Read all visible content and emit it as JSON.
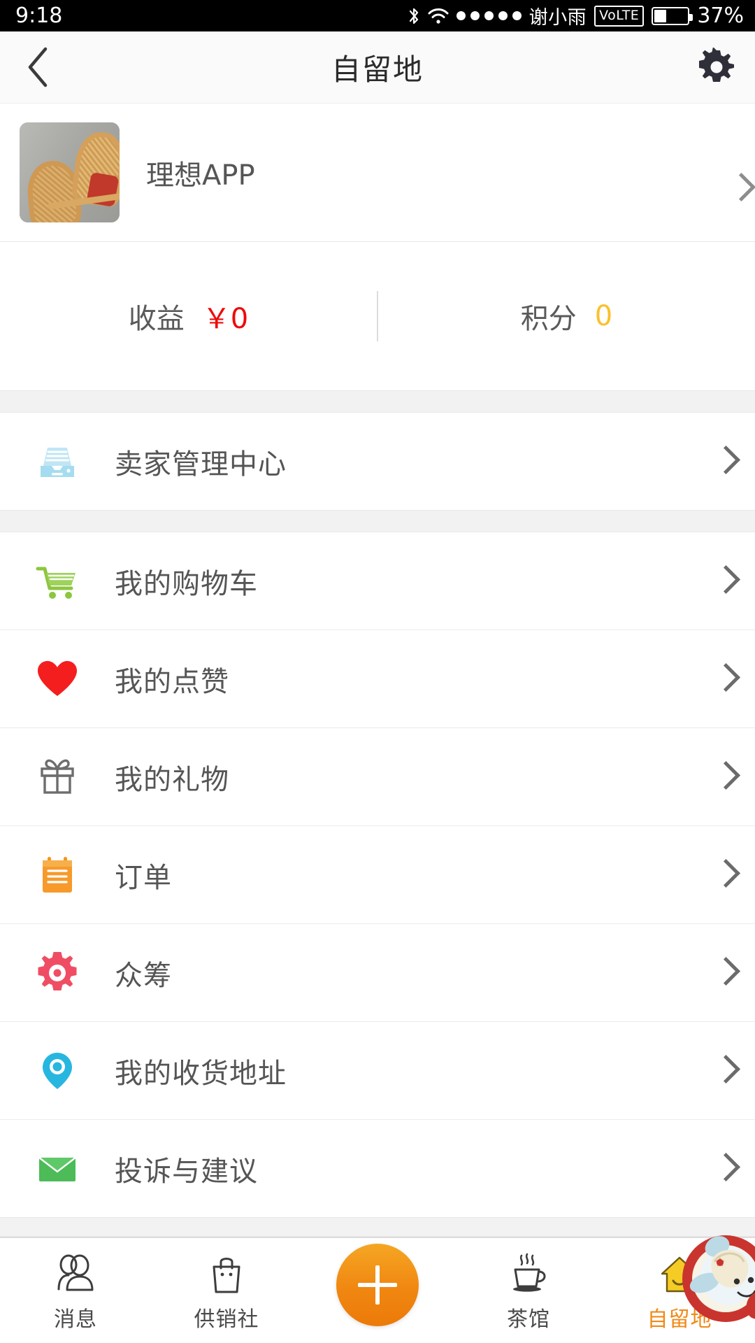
{
  "status_bar": {
    "time": "9:18",
    "icons": [
      "bluetooth-icon",
      "wifi-icon"
    ],
    "signal_dots": 5,
    "carrier": "谢小雨",
    "network_badge": "VoLTE",
    "battery_percent": "37%",
    "battery_level": 37
  },
  "header": {
    "back_icon": "chevron-left-icon",
    "title": "自留地",
    "settings_icon": "gear-icon"
  },
  "profile": {
    "avatar_alt": "rattan-chairs-photo",
    "name": "理想APP",
    "chevron_icon": "chevron-right-icon"
  },
  "stats": [
    {
      "label": "收益",
      "value": "￥0",
      "color": "#ee0a0a",
      "name": "earnings"
    },
    {
      "label": "积分",
      "value": "0",
      "color": "#fbc02d",
      "name": "points"
    }
  ],
  "menu_groups": [
    {
      "items": [
        {
          "label": "卖家管理中心",
          "icon": "inbox-tray-icon",
          "color": "#a6dcef"
        }
      ]
    },
    {
      "items": [
        {
          "label": "我的购物车",
          "icon": "shopping-cart-icon",
          "color": "#7ac143"
        },
        {
          "label": "我的点赞",
          "icon": "heart-icon",
          "color": "#f41e1e"
        },
        {
          "label": "我的礼物",
          "icon": "gift-box-icon",
          "color": "#6d6d6d"
        },
        {
          "label": "订单",
          "icon": "clipboard-icon",
          "color": "#f79a2b"
        },
        {
          "label": "众筹",
          "icon": "gear-crowdfund-icon",
          "color": "#ef4d63"
        },
        {
          "label": "我的收货地址",
          "icon": "map-pin-icon",
          "color": "#27b6e0"
        },
        {
          "label": "投诉与建议",
          "icon": "envelope-icon",
          "color": "#4cbb58"
        }
      ]
    }
  ],
  "tabbar": {
    "items": [
      {
        "label": "消息",
        "icon": "people-icon",
        "active": false
      },
      {
        "label": "供销社",
        "icon": "shopping-bag-icon",
        "active": false
      },
      {
        "label": "茶馆",
        "icon": "teacup-icon",
        "active": false
      },
      {
        "label": "自留地",
        "icon": "house-icon",
        "active": true
      }
    ],
    "center_button": {
      "icon": "plus-icon",
      "color": "#f08711"
    },
    "active_color": "#f08a17",
    "mascot": "cartoon-mascot-decoration"
  }
}
